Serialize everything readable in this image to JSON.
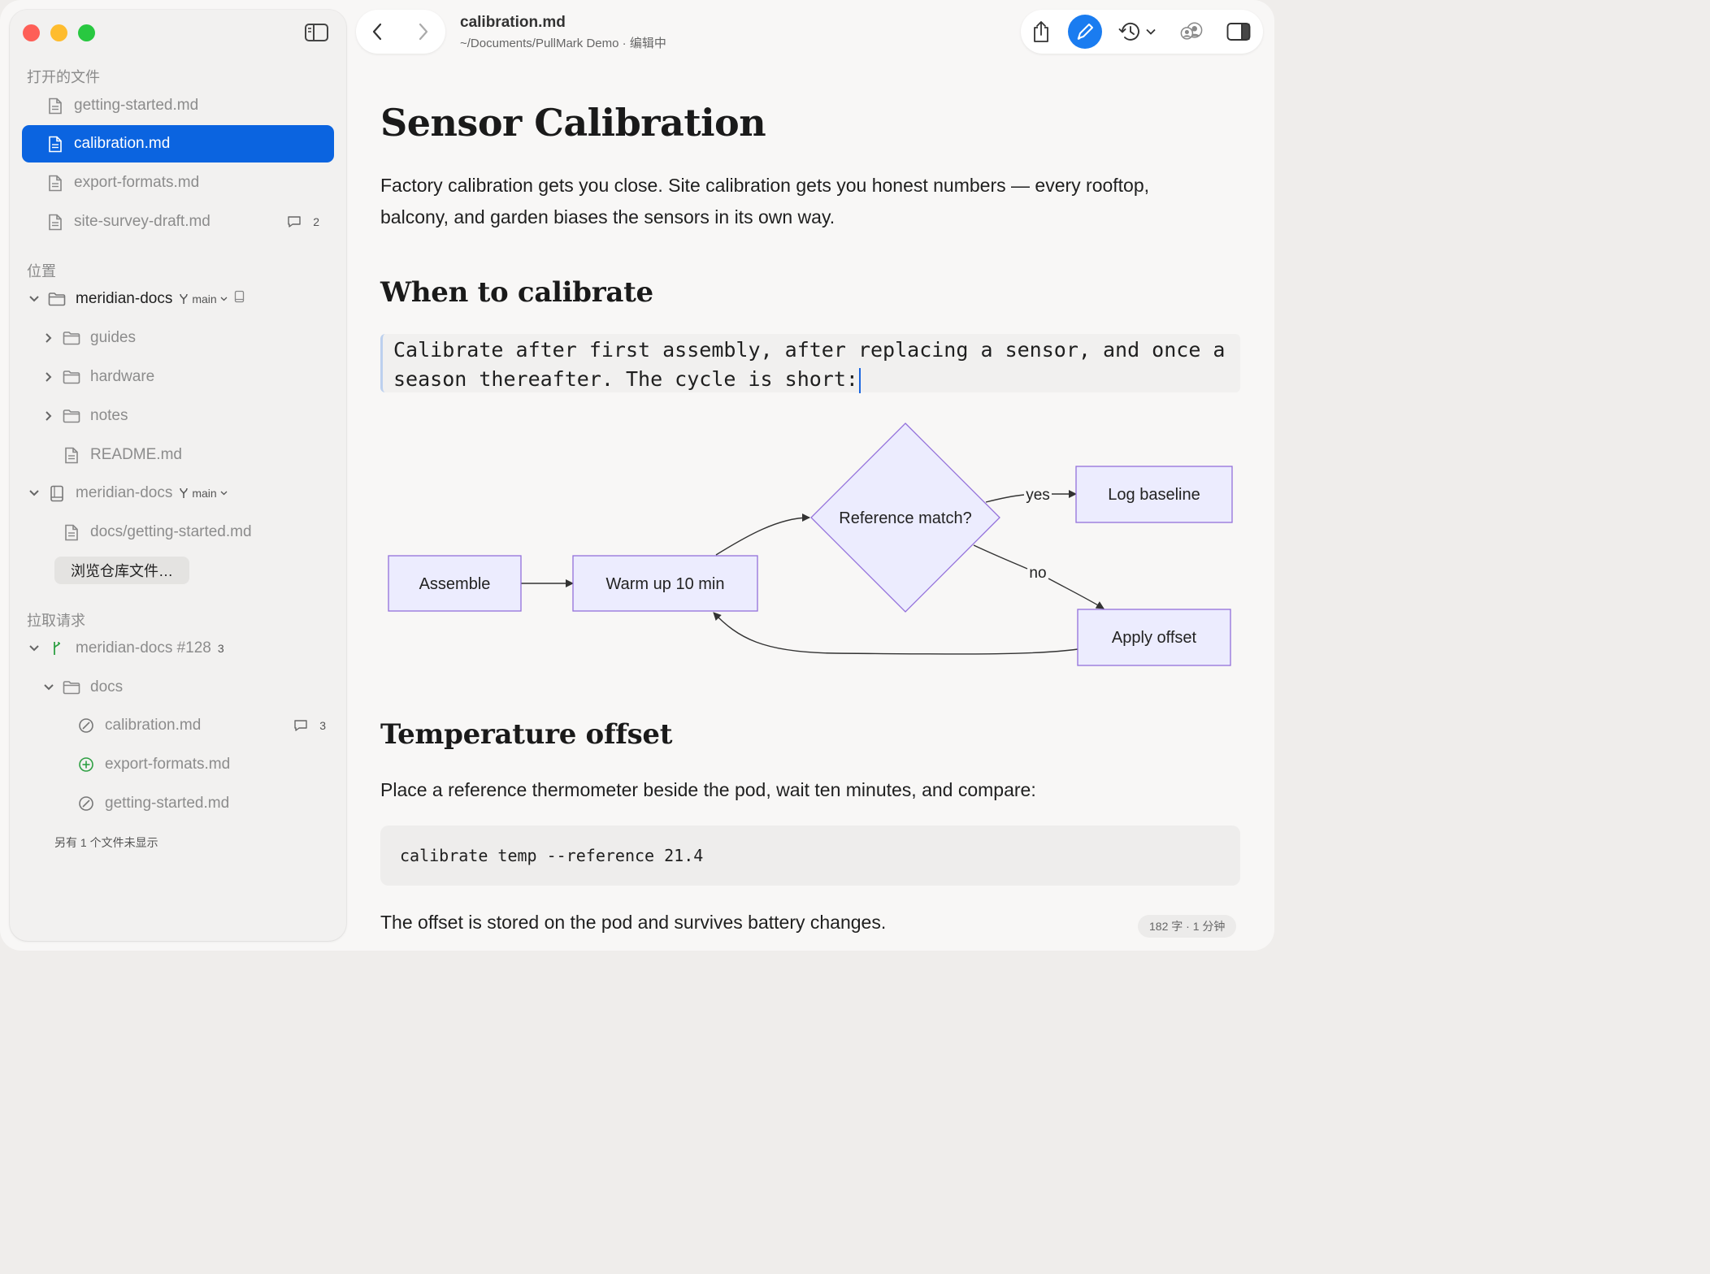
{
  "window": {
    "title": "calibration.md",
    "path": "~/Documents/PullMark Demo · 编辑中"
  },
  "sidebar": {
    "open_files_title": "打开的文件",
    "open_files": [
      {
        "label": "getting-started.md",
        "selected": false
      },
      {
        "label": "calibration.md",
        "selected": true
      },
      {
        "label": "export-formats.md",
        "selected": false
      },
      {
        "label": "site-survey-draft.md",
        "selected": false,
        "comments": "2"
      }
    ],
    "locations_title": "位置",
    "repo1": {
      "name": "meridian-docs",
      "branch": "main"
    },
    "repo1_children": [
      "guides",
      "hardware",
      "notes",
      "README.md"
    ],
    "repo2": {
      "name": "meridian-docs",
      "branch": "main"
    },
    "repo2_children": [
      "docs/getting-started.md"
    ],
    "browse_button": "浏览仓库文件…",
    "pulls_title": "拉取请求",
    "pull": {
      "name": "meridian-docs #128",
      "count": "3"
    },
    "pull_folder": "docs",
    "pull_files": [
      {
        "label": "calibration.md",
        "status": "modified",
        "comments": "3"
      },
      {
        "label": "export-formats.md",
        "status": "added"
      },
      {
        "label": "getting-started.md",
        "status": "modified"
      }
    ],
    "more_files": "另有 1 个文件未显示"
  },
  "document": {
    "h1": "Sensor Calibration",
    "intro_line1": "Factory calibration gets you close. Site calibration gets you honest numbers — every rooftop,",
    "intro_line2": "balcony, and garden biases the sensors in its own way.",
    "h2_when": "When to calibrate",
    "editing_line1": "Calibrate after first assembly, after replacing a sensor, and once a",
    "editing_line2": "season thereafter. The cycle is short:",
    "diagram": {
      "assemble": "Assemble",
      "warm_up": "Warm up 10 min",
      "decision": "Reference match?",
      "log": "Log baseline",
      "apply": "Apply offset",
      "yes": "yes",
      "no": "no"
    },
    "h2_temp": "Temperature offset",
    "temp_para": "Place a reference thermometer beside the pod, wait ten minutes, and compare:",
    "code": "calibrate temp --reference 21.4",
    "closing": "The offset is stored on the pod and survives battery changes.",
    "word_count": "182 字 · 1 分钟"
  },
  "colors": {
    "accent": "#0b64e0",
    "node_fill": "#ececfe",
    "node_stroke": "#9370db"
  }
}
